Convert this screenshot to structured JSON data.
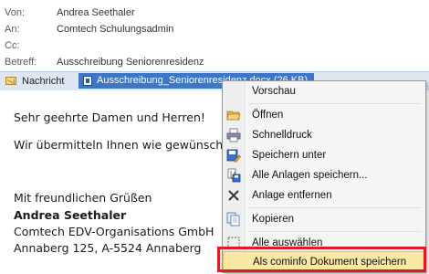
{
  "header": {
    "von_label": "Von:",
    "von_value": "Andrea Seethaler",
    "an_label": "An:",
    "an_value": "Comtech Schulungsadmin",
    "cc_label": "Cc:",
    "cc_value": "",
    "betreff_label": "Betreff:",
    "betreff_value": "Ausschreibung Seniorenresidenz"
  },
  "tabs": {
    "message_label": "Nachricht",
    "attachment_label": "Ausschreibung_Seniorenresidenz.docx (26 KB)"
  },
  "body_lines": {
    "l1": "Sehr geehrte Damen und Herren!",
    "l2": "Wir übermitteln Ihnen wie gewünscht die",
    "l3": "Mit freundlichen Grüßen",
    "l4": "Andrea Seethaler",
    "l5": "Comtech EDV-Organisations GmbH",
    "l6": "Annaberg 125, A-5524 Annaberg"
  },
  "menu": {
    "vorschau": "Vorschau",
    "oeffnen": "Öffnen",
    "schnelldruck": "Schnelldruck",
    "speichern_unter": "Speichern unter",
    "alle_anlagen": "Alle Anlagen speichern...",
    "anlage_entfernen": "Anlage entfernen",
    "kopieren": "Kopieren",
    "alle_auswaehlen": "Alle auswählen",
    "cominfo": "Als cominfo Dokument speichern"
  },
  "colors": {
    "highlight": "#fbe7a6",
    "annotation_box": "#e01b24",
    "attachment_tab": "#3e76c6"
  }
}
